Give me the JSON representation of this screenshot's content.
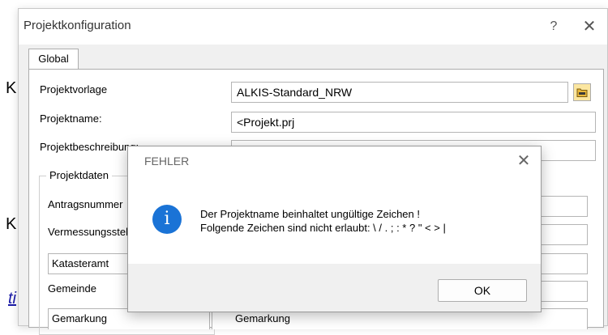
{
  "background": {
    "letter_1": "K",
    "letter_2": "K",
    "link_fragment": "ti"
  },
  "main_dialog": {
    "title": "Projektkonfiguration",
    "help_glyph": "?",
    "close_glyph": "✕",
    "tabs": [
      {
        "label": "Global"
      }
    ],
    "fields": {
      "projektvorlage_label": "Projektvorlage",
      "projektvorlage_value": "ALKIS-Standard_NRW",
      "projektname_label": "Projektname:",
      "projektname_value": "<Projekt.prj",
      "projektbeschreibung_label": "Projektbeschreibung:",
      "projektbeschreibung_value": ""
    },
    "group": {
      "title": "Projektdaten",
      "antragsnummer_label": "Antragsnummer",
      "vermessungsstelle_label": "Vermessungsstelle",
      "katasteramt_combo": "Katasteramt",
      "gemeinde_label": "Gemeinde",
      "gemarkung_combo": "Gemarkung",
      "gemarkung_value": "Gemarkung"
    }
  },
  "error_dialog": {
    "title": "FEHLER",
    "close_glyph": "✕",
    "icon": "info-icon",
    "icon_glyph": "i",
    "message_line1": "Der Projektname beinhaltet ungültige Zeichen !",
    "message_line2": "Folgende Zeichen sind nicht erlaubt: \\ / . ; : * ? \" < > |",
    "ok_label": "OK"
  },
  "colors": {
    "info_icon": "#1a73d6",
    "dialog_bg": "#f0f0f0",
    "link": "#1a1aa6"
  }
}
